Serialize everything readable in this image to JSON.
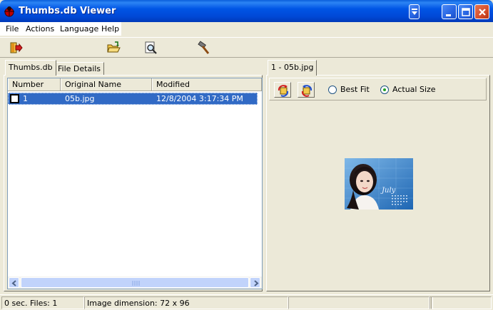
{
  "window": {
    "title": "Thumbs.db Viewer"
  },
  "menu": {
    "items": [
      {
        "label": "File"
      },
      {
        "label": "Actions"
      },
      {
        "label": "Language"
      },
      {
        "label": "Help"
      }
    ]
  },
  "toolbar": {
    "buttons": [
      {
        "icon": "exit-icon"
      },
      {
        "icon": "open-folder-icon"
      },
      {
        "icon": "find-icon"
      },
      {
        "icon": "hammer-icon"
      }
    ]
  },
  "left_tabs": [
    {
      "label": "Thumbs.db"
    },
    {
      "label": "File Details"
    }
  ],
  "list": {
    "columns": [
      "Number",
      "Original Name",
      "Modified"
    ],
    "rows": [
      {
        "number": "1",
        "name": "05b.jpg",
        "modified": "12/8/2004 3:17:34 PM",
        "selected": true,
        "checked": false
      }
    ]
  },
  "right_tab": {
    "label": "1 - 05b.jpg"
  },
  "view_options": {
    "best_fit_label": "Best Fit",
    "actual_size_label": "Actual Size",
    "selected": "Actual Size"
  },
  "thumbnail": {
    "caption": "July"
  },
  "status": {
    "files": "0 sec. Files: 1",
    "dimension": "Image dimension: 72 x 96",
    "panel3": "",
    "panel4": "",
    "panel5": ""
  },
  "colors": {
    "selection": "#316AC5",
    "titlebar": "#0055E5",
    "face": "#ECE9D8"
  }
}
